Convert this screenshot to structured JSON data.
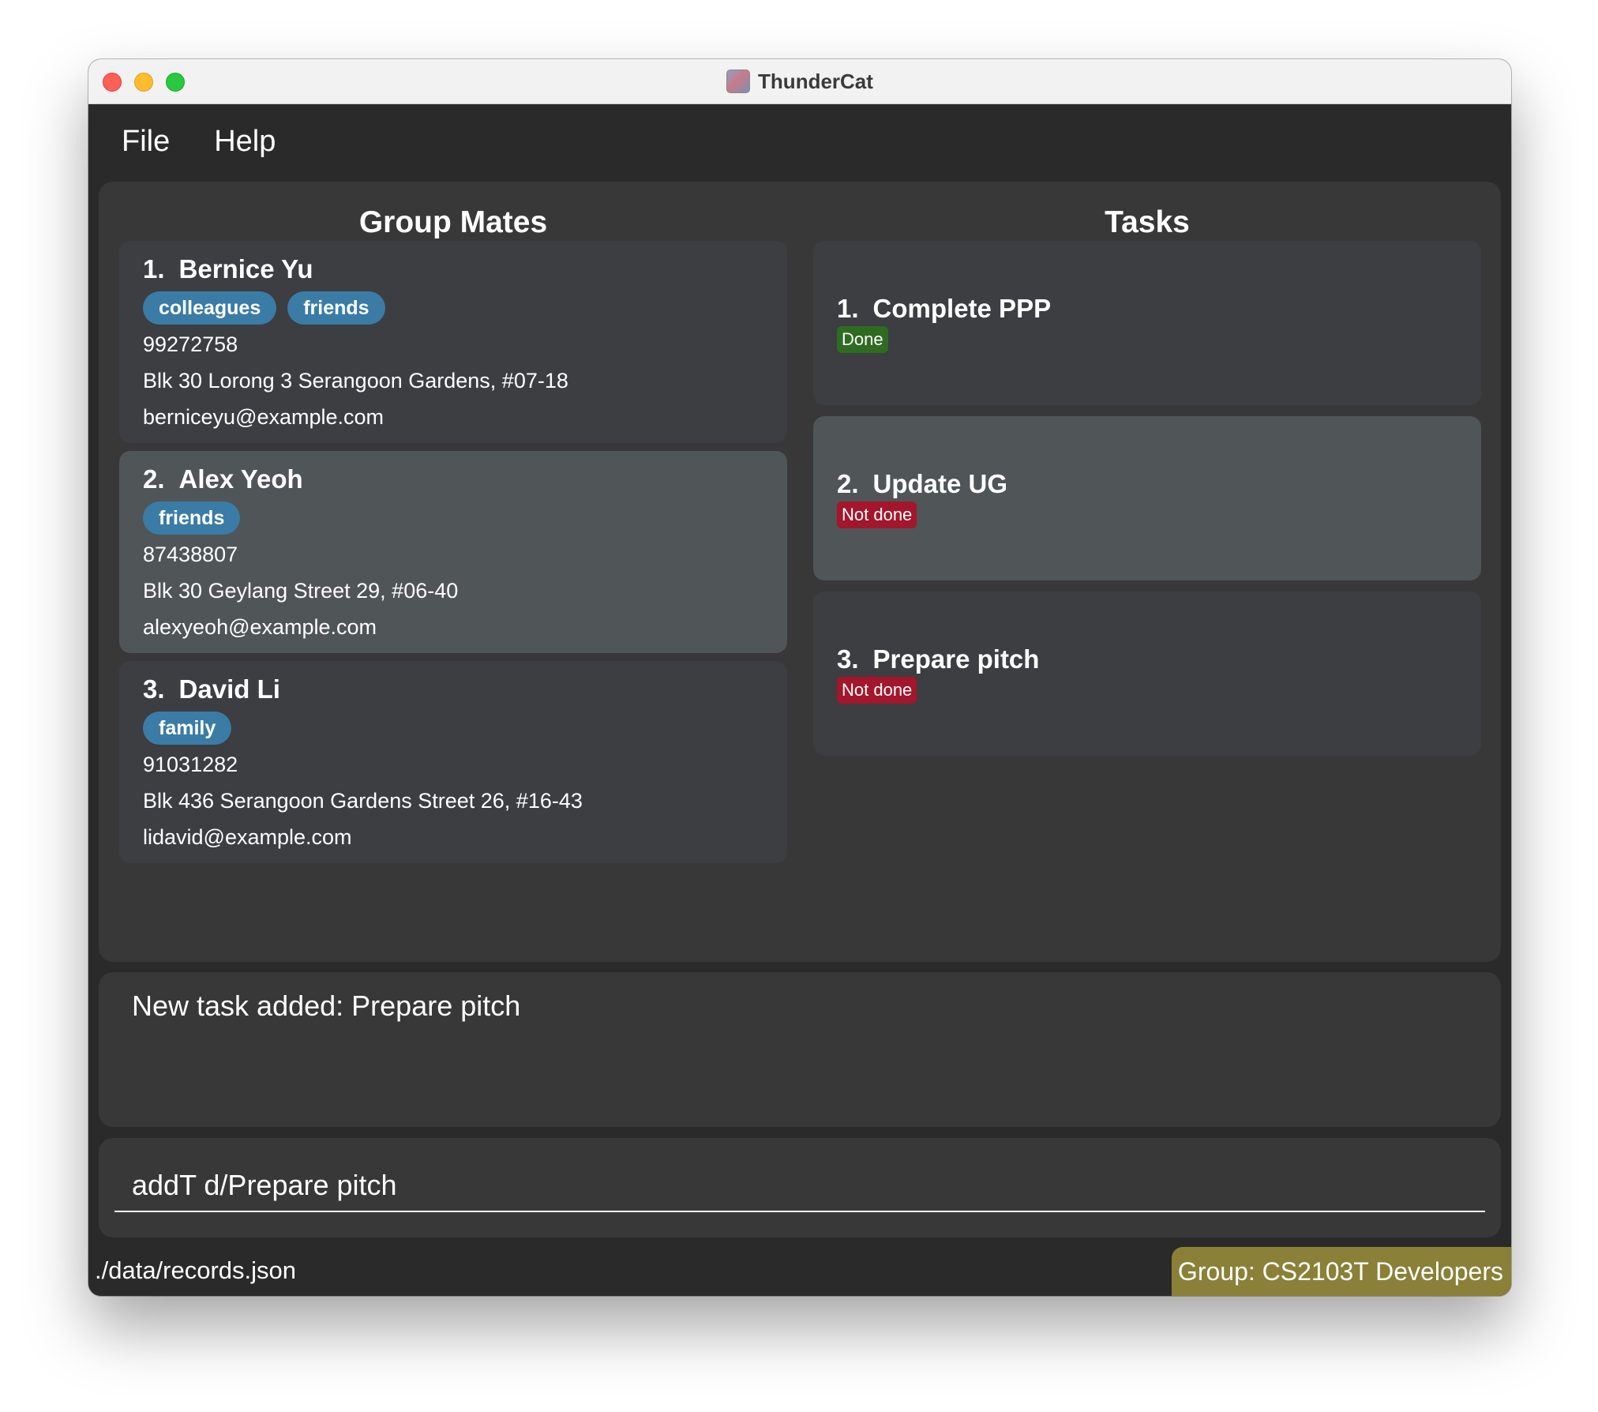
{
  "window": {
    "title": "ThunderCat"
  },
  "menu": {
    "file": "File",
    "help": "Help"
  },
  "columns": {
    "left_title": "Group Mates",
    "right_title": "Tasks"
  },
  "persons": [
    {
      "index": "1.",
      "name": "Bernice Yu",
      "tags": [
        "colleagues",
        "friends"
      ],
      "phone": "99272758",
      "address": "Blk 30 Lorong 3 Serangoon Gardens, #07-18",
      "email": "berniceyu@example.com"
    },
    {
      "index": "2.",
      "name": "Alex Yeoh",
      "tags": [
        "friends"
      ],
      "phone": "87438807",
      "address": "Blk 30 Geylang Street 29, #06-40",
      "email": "alexyeoh@example.com"
    },
    {
      "index": "3.",
      "name": "David Li",
      "tags": [
        "family"
      ],
      "phone": "91031282",
      "address": "Blk 436 Serangoon Gardens Street 26, #16-43",
      "email": "lidavid@example.com"
    }
  ],
  "tasks": [
    {
      "index": "1.",
      "name": "Complete PPP",
      "status": "Done"
    },
    {
      "index": "2.",
      "name": "Update UG",
      "status": "Not done"
    },
    {
      "index": "3.",
      "name": "Prepare pitch",
      "status": "Not done"
    }
  ],
  "result": {
    "message": "New task added: Prepare pitch"
  },
  "command": {
    "value": "addT d/Prepare pitch"
  },
  "statusbar": {
    "path": "./data/records.json",
    "group": "Group: CS2103T Developers"
  },
  "colors": {
    "tag": "#3a7ca5",
    "done": "#2f6b21",
    "not_done": "#a3162b",
    "group_badge": "#8a8037"
  }
}
